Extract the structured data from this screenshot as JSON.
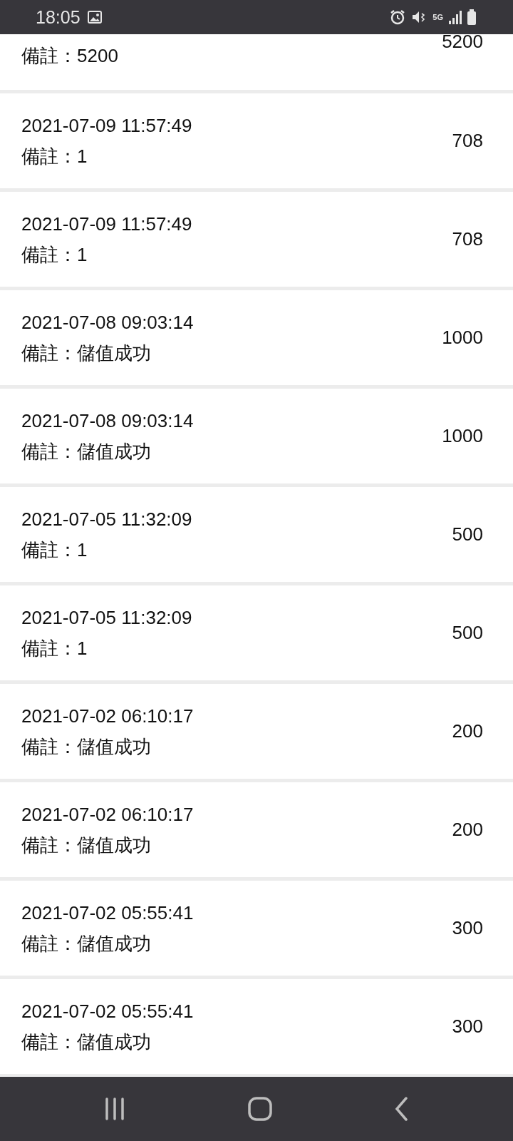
{
  "status_bar": {
    "time": "18:05",
    "network": "5G"
  },
  "records": [
    {
      "remark": "備註：5200",
      "amount": "5200",
      "partial": true
    },
    {
      "date": "2021-07-09 11:57:49",
      "remark": "備註：1",
      "amount": "708",
      "partial": false
    },
    {
      "date": "2021-07-09 11:57:49",
      "remark": "備註：1",
      "amount": "708",
      "partial": false
    },
    {
      "date": "2021-07-08 09:03:14",
      "remark": "備註：儲值成功",
      "amount": "1000",
      "partial": false
    },
    {
      "date": "2021-07-08 09:03:14",
      "remark": "備註：儲值成功",
      "amount": "1000",
      "partial": false
    },
    {
      "date": "2021-07-05 11:32:09",
      "remark": "備註：1",
      "amount": "500",
      "partial": false
    },
    {
      "date": "2021-07-05 11:32:09",
      "remark": "備註：1",
      "amount": "500",
      "partial": false
    },
    {
      "date": "2021-07-02 06:10:17",
      "remark": "備註：儲值成功",
      "amount": "200",
      "partial": false
    },
    {
      "date": "2021-07-02 06:10:17",
      "remark": "備註：儲值成功",
      "amount": "200",
      "partial": false
    },
    {
      "date": "2021-07-02 05:55:41",
      "remark": "備註：儲值成功",
      "amount": "300",
      "partial": false
    },
    {
      "date": "2021-07-02 05:55:41",
      "remark": "備註：儲值成功",
      "amount": "300",
      "partial": false
    }
  ]
}
